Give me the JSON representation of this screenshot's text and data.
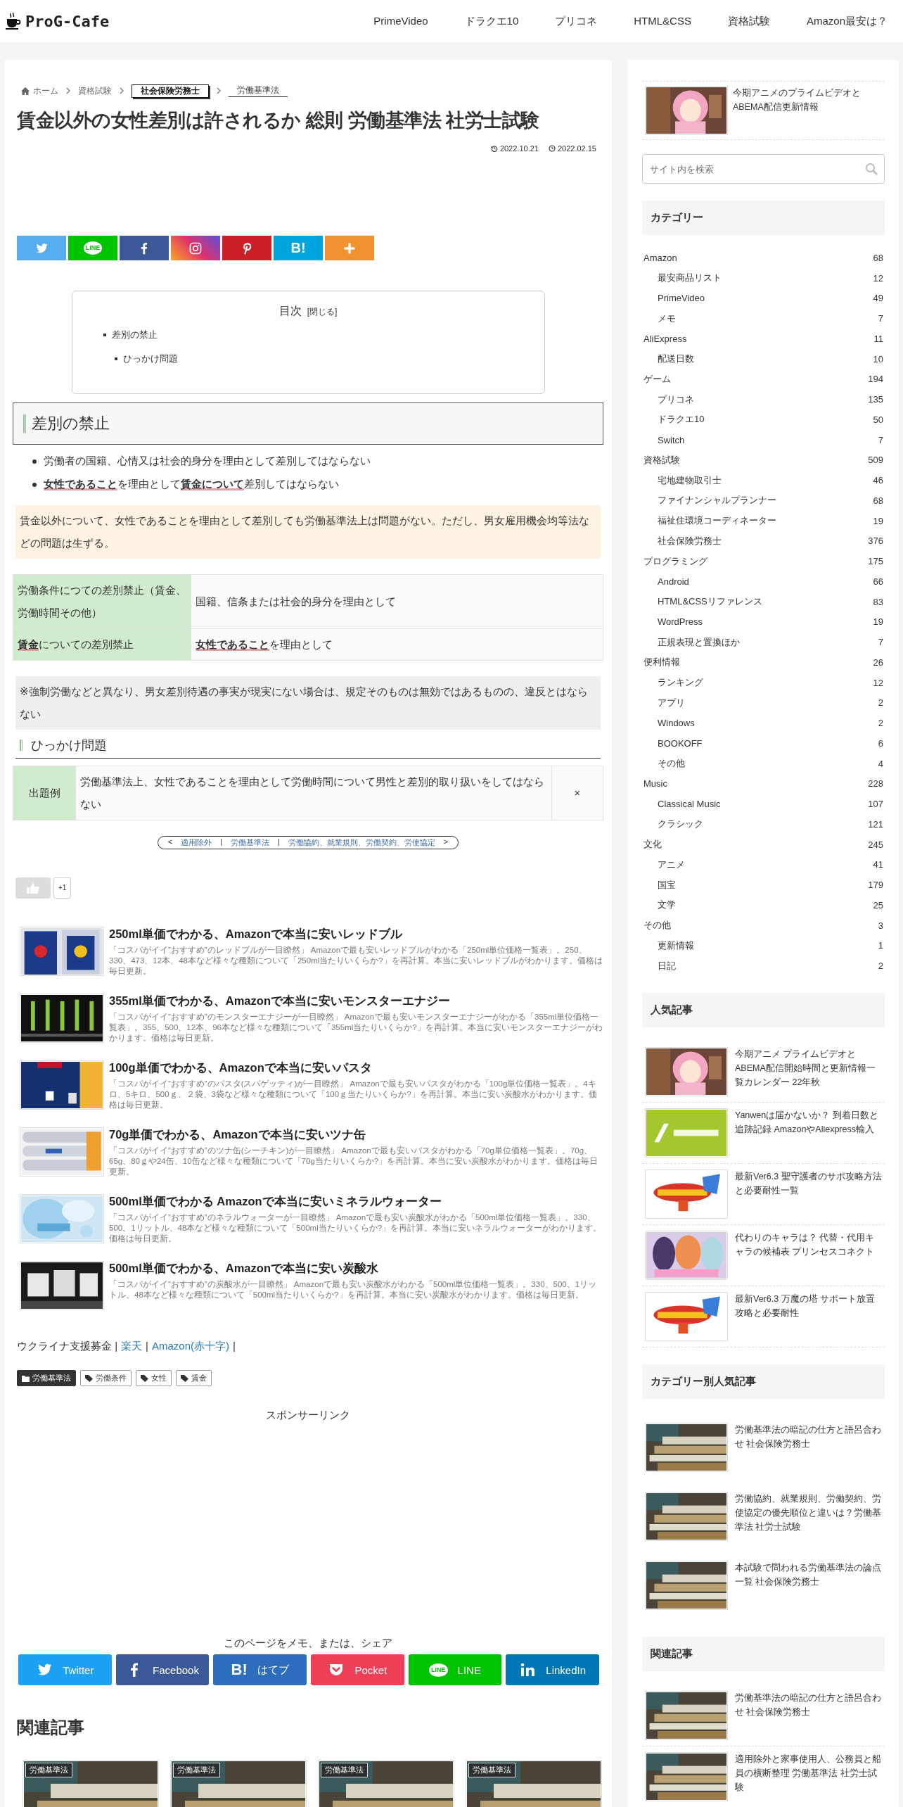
{
  "header": {
    "logo": "ProG-Cafe",
    "nav": [
      "PrimeVideo",
      "ドラクエ10",
      "プリコネ",
      "HTML&CSS",
      "資格試験",
      "Amazon最安は？"
    ]
  },
  "breadcrumb": [
    {
      "label": "ホーム",
      "kind": "home"
    },
    {
      "label": "資格試験",
      "kind": "plain"
    },
    {
      "label": "社会保険労務士",
      "kind": "boxed"
    },
    {
      "label": "労働基準法",
      "kind": "underlined"
    }
  ],
  "title": "賃金以外の女性差別は許されるか 総則 労働基準法 社労士試験",
  "dates": [
    {
      "kind": "updated",
      "text": "2022.10.21"
    },
    {
      "kind": "published",
      "text": "2022.02.15"
    }
  ],
  "share_top": [
    {
      "kind": "twitter"
    },
    {
      "kind": "line",
      "label": "LINE"
    },
    {
      "kind": "facebook"
    },
    {
      "kind": "instagram"
    },
    {
      "kind": "pinterest"
    },
    {
      "kind": "hatena",
      "label": "B!"
    },
    {
      "kind": "more"
    }
  ],
  "toc": {
    "title": "目次",
    "toggle": "[閉じる]",
    "items": [
      {
        "label": "差別の禁止",
        "children": [
          {
            "label": "ひっかけ問題"
          }
        ]
      }
    ]
  },
  "section_heading": "差別の禁止",
  "bullets": [
    "労働者の国籍、心情又は社会的身分を理由として差別してはならない",
    "**女性であること**を理由として**賃金について**差別してはならない"
  ],
  "notice": "賃金以外について、女性であることを理由として差別しても労働基準法上は問題がない。ただし、男女雇用機会均等法などの問題は生ずる。",
  "table": [
    {
      "label": "労働条件につての差別禁止（賃金、労働時間その他）",
      "value": "国籍、信条または社会的身分を理由として"
    },
    {
      "label": "**賃金**についての差別禁止",
      "value": "**女性であること**を理由として"
    }
  ],
  "note": "※強制労働などと異なり、男女差別待遇の事実が現実にない場合は、規定そのものは無効ではあるものの、違反とはならない",
  "sub_heading": "ひっかけ問題",
  "question": {
    "label": "出題例",
    "text": "労働基準法上、女性であることを理由として労働時間について男性と差別的取り扱いをしてはならない",
    "answer": "×"
  },
  "pager": [
    {
      "kind": "arrow",
      "text": "<"
    },
    {
      "kind": "link",
      "text": "適用除外"
    },
    {
      "kind": "sep",
      "text": "|"
    },
    {
      "kind": "link",
      "text": "労働基準法"
    },
    {
      "kind": "sep",
      "text": "|"
    },
    {
      "kind": "link",
      "text": "労働協約、就業規則、労働契約、労使協定"
    },
    {
      "kind": "arrow",
      "text": ">"
    }
  ],
  "like": {
    "count": "+1"
  },
  "related_list": [
    {
      "title": "250ml単価でわかる、Amazonで本当に安いレッドブル",
      "excerpt": "「コスパがイイ”おすすめ”のレッドブルが一目瞭然」 Amazonで最も安いレッドブルがわかる「250ml単位価格一覧表」。250、330、473、12本、48本など様々な種類について「250ml当たりいくらか?」を再計算。本当に安いレッドブルがわかります。価格は毎日更新。"
    },
    {
      "title": "355ml単価でわかる、Amazonで本当に安いモンスターエナジー",
      "excerpt": "「コスパがイイ”おすすめ”のモンスターエナジーが一目瞭然」 Amazonで最も安いモンスターエナジーがわかる「355ml単位価格一覧表」。355、500、12本、96本など様々な種類について「355ml当たりいくらか?」を再計算。本当に安いモンスターエナジーがわかります。価格は毎日更新。"
    },
    {
      "title": "100g単価でわかる、Amazonで本当に安いパスタ",
      "excerpt": "「コスパがイイ”おすすめ”のパスタ(スパゲッティ)が一目瞭然」 Amazonで最も安いパスタがわかる「100g単位価格一覧表」。4キロ、5キロ、500ｇ、２袋、3袋など様々な種類について「100ｇ当たりいくらか?」を再計算。本当に安い炭酸水がわかります。価格は毎日更新。"
    },
    {
      "title": "70g単価でわかる、Amazonで本当に安いツナ缶",
      "excerpt": "「コスパがイイ”おすすめ”のツナ缶(シーチキン)が一目瞭然」 Amazonで最も安いパスタがわかる「70g単位価格一覧表」。70g、65g、80ｇや24缶、10缶など様々な種類について「70g当たりいくらか?」を再計算。本当に安い炭酸水がわかります。価格は毎日更新。"
    },
    {
      "title": "500ml単価でわかる Amazonで本当に安いミネラルウォーター",
      "excerpt": "「コスパがイイ”おすすめ”のネラルウォーターが一目瞭然」 Amazonで最も安い炭酸水がわかる「500ml単位価格一覧表」。330、500、1リットル、48本など様々な種類について「500ml当たりいくらか?」を再計算。本当に安いネラルウォーターがわかります。価格は毎日更新。"
    },
    {
      "title": "500ml単価でわかる、Amazonで本当に安い炭酸水",
      "excerpt": "「コスパがイイ”おすすめ”の炭酸水が一目瞭然」 Amazonで最も安い炭酸水がわかる「500ml単位価格一覧表」。330、500、1リットル、48本など様々な種類について「500ml当たりいくらか?」を再計算。本当に安い炭酸水がわかります。価格は毎日更新。"
    }
  ],
  "donation": [
    {
      "kind": "text",
      "text": "ウクライナ支援募金 |"
    },
    {
      "kind": "link",
      "text": "楽天"
    },
    {
      "kind": "text",
      "text": "|"
    },
    {
      "kind": "link",
      "text": "Amazon(赤十字)"
    },
    {
      "kind": "text",
      "text": "|"
    }
  ],
  "tags": [
    {
      "kind": "category",
      "label": "労働基準法"
    },
    {
      "kind": "tag",
      "label": "労働条件"
    },
    {
      "kind": "tag",
      "label": "女性"
    },
    {
      "kind": "tag",
      "label": "賃金"
    }
  ],
  "sponsor": "スポンサーリンク",
  "share_bottom": {
    "title": "このページをメモ、または、シェア",
    "buttons": [
      {
        "kind": "twitter",
        "label": "Twitter"
      },
      {
        "kind": "facebook",
        "label": "Facebook"
      },
      {
        "kind": "hatena",
        "icon_text": "B!",
        "label": "はてブ"
      },
      {
        "kind": "pocket",
        "label": "Pocket"
      },
      {
        "kind": "line",
        "icon_text": "LINE",
        "label": "LINE"
      },
      {
        "kind": "linkedin",
        "label": "LinkedIn"
      }
    ]
  },
  "related_heading": "関連記事",
  "related_cards": [
    {
      "category": "労働基準法"
    },
    {
      "category": "労働基準法"
    },
    {
      "category": "労働基準法"
    },
    {
      "category": "労働基準法"
    }
  ],
  "sidebar": {
    "top_article": {
      "title": "今期アニメのプライムビデオとABEMA配信更新情報"
    },
    "search": {
      "placeholder": "サイト内を検索"
    },
    "categories_heading": "カテゴリー",
    "categories": [
      {
        "name": "Amazon",
        "count": "68",
        "children": [
          {
            "name": "最安商品リスト",
            "count": "12"
          },
          {
            "name": "PrimeVideo",
            "count": "49"
          },
          {
            "name": "メモ",
            "count": "7"
          }
        ]
      },
      {
        "name": "AliExpress",
        "count": "11",
        "children": [
          {
            "name": "配送日数",
            "count": "10"
          }
        ]
      },
      {
        "name": "ゲーム",
        "count": "194",
        "children": [
          {
            "name": "プリコネ",
            "count": "135"
          },
          {
            "name": "ドラクエ10",
            "count": "50"
          },
          {
            "name": "Switch",
            "count": "7"
          }
        ]
      },
      {
        "name": "資格試験",
        "count": "509",
        "children": [
          {
            "name": "宅地建物取引士",
            "count": "46"
          },
          {
            "name": "ファイナンシャルプランナー",
            "count": "68"
          },
          {
            "name": "福祉住環境コーディネーター",
            "count": "19"
          },
          {
            "name": "社会保険労務士",
            "count": "376"
          }
        ]
      },
      {
        "name": "プログラミング",
        "count": "175",
        "children": [
          {
            "name": "Android",
            "count": "66"
          },
          {
            "name": "HTML&CSSリファレンス",
            "count": "83"
          },
          {
            "name": "WordPress",
            "count": "19"
          },
          {
            "name": "正規表現と置換ほか",
            "count": "7"
          }
        ]
      },
      {
        "name": "便利情報",
        "count": "26",
        "children": [
          {
            "name": "ランキング",
            "count": "12"
          },
          {
            "name": "アプリ",
            "count": "2"
          },
          {
            "name": "Windows",
            "count": "2"
          },
          {
            "name": "BOOKOFF",
            "count": "6"
          },
          {
            "name": "その他",
            "count": "4"
          }
        ]
      },
      {
        "name": "Music",
        "count": "228",
        "children": [
          {
            "name": "Classical Music",
            "count": "107"
          },
          {
            "name": "クラシック",
            "count": "121"
          }
        ]
      },
      {
        "name": "文化",
        "count": "245",
        "children": [
          {
            "name": "アニメ",
            "count": "41"
          },
          {
            "name": "国宝",
            "count": "179"
          },
          {
            "name": "文学",
            "count": "25"
          }
        ]
      },
      {
        "name": "その他",
        "count": "3",
        "children": [
          {
            "name": "更新情報",
            "count": "1"
          },
          {
            "name": "日記",
            "count": "2"
          }
        ]
      }
    ],
    "popular_heading": "人気記事",
    "popular": [
      {
        "title": "今期アニメ プライムビデオとABEMA配信開始時間と更新情報一覧カレンダー 22年秋"
      },
      {
        "title": "Yanwenは届かないか？ 到着日数と追跡記録 AmazonやAliexpress輸入"
      },
      {
        "title": "最新Ver6.3 聖守護者のサポ攻略方法と必要耐性一覧"
      },
      {
        "title": "代わりのキャラは？ 代替・代用キャラの候補表 プリンセスコネクト"
      },
      {
        "title": "最新Ver6.3 万魔の塔 サポート放置攻略と必要耐性"
      }
    ],
    "category_popular_heading": "カテゴリー別人気記事",
    "category_popular": [
      {
        "title": "労働基準法の暗記の仕方と語呂合わせ 社会保険労務士"
      },
      {
        "title": "労働協約、就業規則、労働契約、労使協定の優先順位と違いは？労働基準法 社労士試験"
      },
      {
        "title": "本試験で問われる労働基準法の論点一覧 社会保険労務士"
      }
    ],
    "related_heading": "関連記事",
    "related": [
      {
        "title": "労働基準法の暗記の仕方と語呂合わせ 社会保険労務士"
      },
      {
        "title": "適用除外と家事使用人、公務員と船員の横断整理 労働基準法 社労士試験"
      }
    ]
  }
}
